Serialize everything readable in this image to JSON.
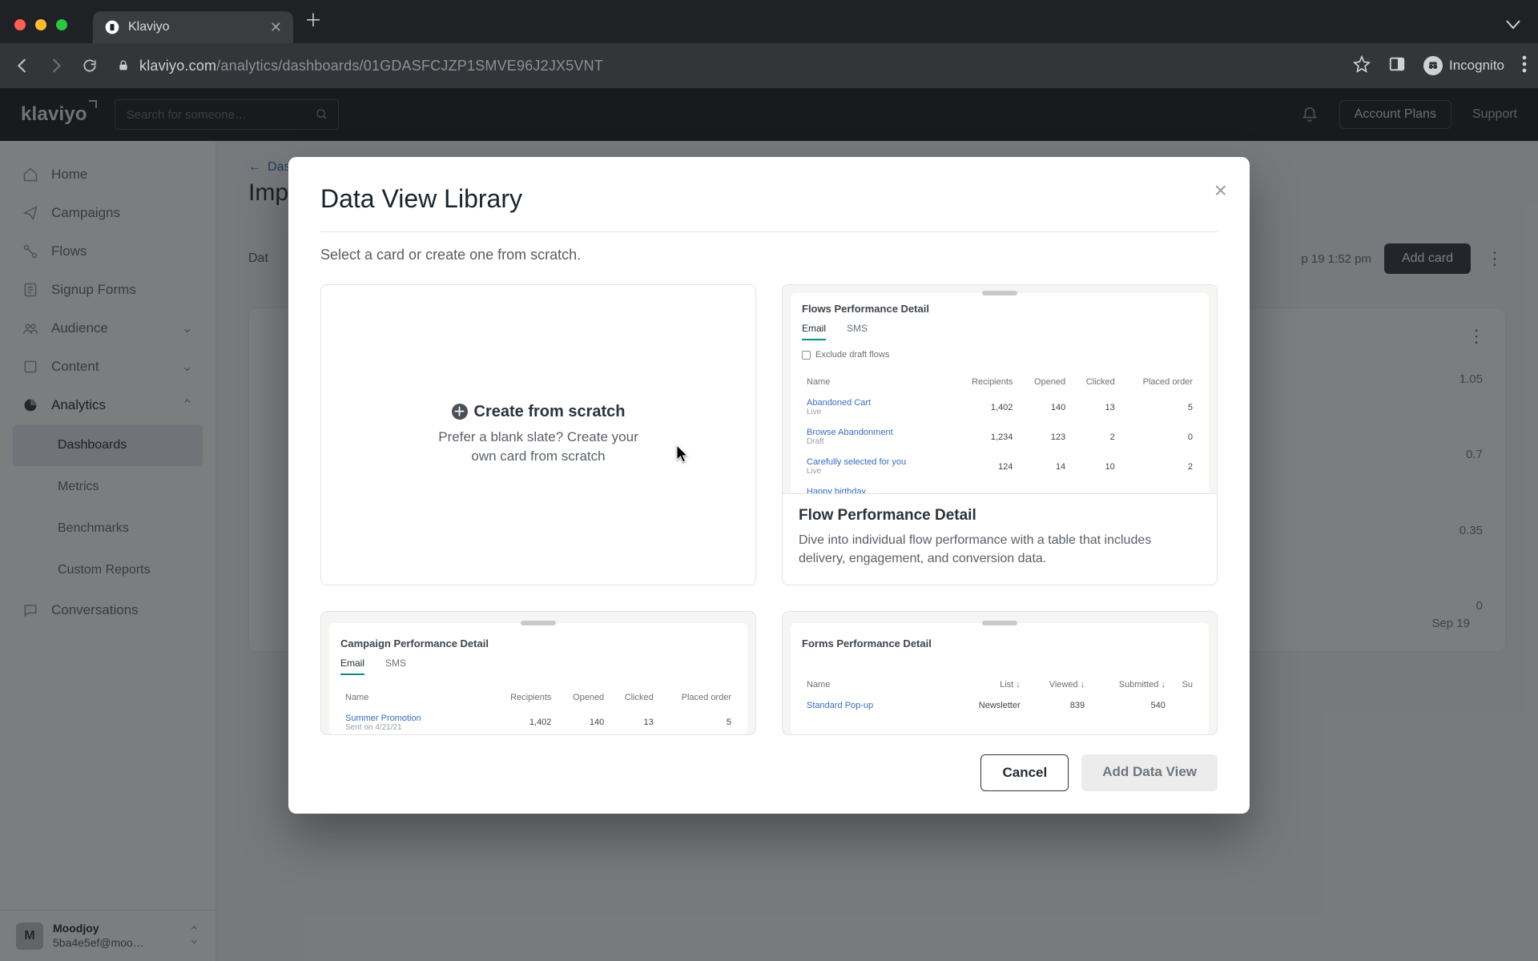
{
  "browser": {
    "tab_title": "Klaviyo",
    "url_host": "klaviyo.com",
    "url_path": "/analytics/dashboards/01GDASFCJZP1SMVE96J2JX5VNT",
    "incognito_label": "Incognito"
  },
  "topbar": {
    "logo": "klaviyo",
    "search_placeholder": "Search for someone…",
    "account_button": "Account Plans",
    "support_link": "Support"
  },
  "sidebar": {
    "items": [
      {
        "label": "Home"
      },
      {
        "label": "Campaigns"
      },
      {
        "label": "Flows"
      },
      {
        "label": "Signup Forms"
      },
      {
        "label": "Audience"
      },
      {
        "label": "Content"
      },
      {
        "label": "Analytics"
      },
      {
        "label": "Conversations"
      }
    ],
    "analytics_sub": [
      "Dashboards",
      "Metrics",
      "Benchmarks",
      "Custom Reports"
    ],
    "account": {
      "initial": "M",
      "name": "Moodjoy",
      "email": "5ba4e5ef@moo…"
    }
  },
  "page": {
    "breadcrumb": "Dashboards",
    "title_prefix": "Imp",
    "data_label_prefix": "Dat",
    "last_saved": "p 19 1:52 pm",
    "add_card": "Add card",
    "yaxis": [
      "1.05",
      "0.7",
      "0.35",
      "0"
    ],
    "xend": "Sep 19"
  },
  "modal": {
    "title": "Data View Library",
    "subtitle": "Select a card or create one from scratch.",
    "blank": {
      "heading": "Create from scratch",
      "body": "Prefer a blank slate? Create your own card from scratch"
    },
    "flows_card": {
      "title": "Flow Performance Detail",
      "blurb": "Dive into individual flow performance with a table that includes delivery, engagement, and conversion data.",
      "preview": {
        "title": "Flows Performance Detail",
        "tabs": [
          "Email",
          "SMS"
        ],
        "checkbox": "Exclude draft flows",
        "columns": [
          "Name",
          "Recipients",
          "Opened",
          "Clicked",
          "Placed order"
        ],
        "rows": [
          {
            "name": "Abandoned Cart",
            "status": "Live",
            "r": "1,402",
            "o": "140",
            "c": "13",
            "p": "5"
          },
          {
            "name": "Browse Abandonment",
            "status": "Draft",
            "r": "1,234",
            "o": "123",
            "c": "2",
            "p": "0"
          },
          {
            "name": "Carefully selected for you",
            "status": "Live",
            "r": "124",
            "o": "14",
            "c": "10",
            "p": "2"
          },
          {
            "name": "Happy birthday",
            "status": "",
            "r": "",
            "o": "",
            "c": "",
            "p": ""
          }
        ]
      }
    },
    "campaign_card": {
      "preview": {
        "title": "Campaign Performance Detail",
        "tabs": [
          "Email",
          "SMS"
        ],
        "columns": [
          "Name",
          "Recipients",
          "Opened",
          "Clicked",
          "Placed order"
        ],
        "rows": [
          {
            "name": "Summer Promotion",
            "status": "Sent on 4/21/21",
            "r": "1,402",
            "o": "140",
            "c": "13",
            "p": "5"
          }
        ]
      }
    },
    "forms_card": {
      "preview": {
        "title": "Forms Performance Detail",
        "columns": [
          "Name",
          "List ↓",
          "Viewed ↓",
          "Submitted ↓",
          "Su"
        ],
        "rows": [
          {
            "name": "Standard Pop-up",
            "list": "Newsletter",
            "v": "839",
            "s": "540"
          }
        ]
      }
    },
    "buttons": {
      "cancel": "Cancel",
      "add": "Add Data View"
    }
  }
}
